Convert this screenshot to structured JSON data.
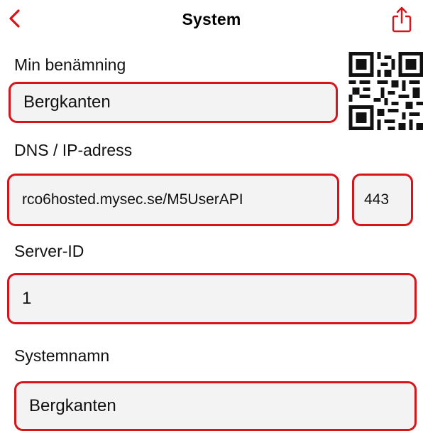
{
  "header": {
    "title": "System",
    "back_icon": "chevron-left-icon",
    "share_icon": "share-icon",
    "accent_color": "#d6141a"
  },
  "form": {
    "name_label": "Min benämning",
    "name_value": "Bergkanten",
    "dns_label": "DNS / IP-adress",
    "dns_value": "rco6hosted.mysec.se/M5UserAPI",
    "port_value": "443",
    "server_label": "Server-ID",
    "server_value": "1",
    "system_label": "Systemnamn",
    "system_value": "Bergkanten"
  },
  "qr_icon": "qr-code-icon"
}
